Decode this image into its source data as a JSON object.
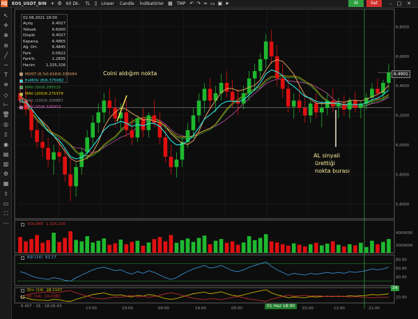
{
  "toolbar": {
    "logo": "iQ",
    "symbol": "EOS_USDT_BIN",
    "add_icon": "+",
    "interval": "60 Dk.",
    "currency": "TL",
    "scale": "Lineer",
    "chart_type": "Candle",
    "indicators": "İndikatörler",
    "template": "TMP",
    "buy": "Al",
    "sell": "Sat"
  },
  "sidebar": {
    "icons": [
      "pointer-icon",
      "crosshair-icon",
      "zoom-in-icon",
      "zoom-out-icon",
      "trendline-icon",
      "horizontal-line-icon",
      "text-icon",
      "fibonacci-icon",
      "shapes-icon",
      "ruler-icon",
      "delete-icon",
      "magnet-icon",
      "lock-icon",
      "eye-icon",
      "layers-icon",
      "template-icon",
      "settings-icon",
      "grid-icon",
      "export-icon",
      "print-icon",
      "fullscreen-icon",
      "more-icon"
    ]
  },
  "infobox": {
    "date": "02.06.2021 18:00",
    "rows": [
      {
        "label": "Açılış",
        "value": "6.4027"
      },
      {
        "label": "Yüksek",
        "value": "6.6000"
      },
      {
        "label": "Düşük",
        "value": "6.4027"
      },
      {
        "label": "Kapanış",
        "value": "6.4865"
      },
      {
        "label": "Ağ. Ort.",
        "value": "6.4845"
      },
      {
        "label": "Fark",
        "value": "0.0622"
      },
      {
        "label": "Fark%",
        "value": "1.2835"
      },
      {
        "label": "Hacim",
        "value": "1,325,326"
      }
    ]
  },
  "legend": [
    {
      "text": "MOST (8,%0.618)6.335684",
      "color": "#e8a060"
    },
    {
      "text": "ExMOV (8)6.375082",
      "color": "#2ee8e8"
    },
    {
      "text": "MAV (50)6.285525",
      "color": "#3ab04a"
    },
    {
      "text": "MAV (200)6.275379",
      "color": "#f0d000"
    },
    {
      "text": "MAV (100)6.206887",
      "color": "#555555"
    },
    {
      "text": "MAV (20)6.326933",
      "color": "#e060c0"
    }
  ],
  "annotations": {
    "bought": "Coini aldığım nokta",
    "signal_line1": "AL sinyali",
    "signal_line2": "ürettiği",
    "signal_line3": "nokta burası"
  },
  "price_axis": {
    "labels": [
      "6,8000",
      "6,6000",
      "6,4000",
      "6,2000",
      "6,0000",
      "5,8000",
      "5,6000"
    ],
    "last_price": "6.4901"
  },
  "volume_panel": {
    "label": "VOLUME",
    "value": "1,325,326",
    "axis_labels": [
      "4000000",
      "2000000"
    ],
    "color": "#d02020"
  },
  "rsi_panel": {
    "label": "RSI (14)",
    "value": "61.17",
    "axis_labels": [
      "80.00",
      "60.00",
      "40.00"
    ],
    "color": "#3a8fd0"
  },
  "dmi_panel": {
    "label_plus": "DI+ (14)",
    "value_plus": "28.1107",
    "label_minus": "DI- (14)",
    "value_minus": "19.2383",
    "axis_labels": [
      "20.00"
    ],
    "tag_value": "34",
    "color_plus": "#e8c800",
    "color_minus": "#d03030"
  },
  "time_axis": {
    "labels": [
      "13:00",
      "23:00",
      "09:00",
      "19:00",
      "05:00",
      "15:00",
      "01:00",
      "11:00",
      "21:00"
    ],
    "cursor_label": "01 Haz 18:00",
    "status": "6.407 - 16 - 18:26:43"
  },
  "colors": {
    "up": "#1fb82f",
    "down": "#e01010",
    "background": "#0d0d0d",
    "grid": "#222222"
  },
  "chart_data": {
    "type": "candlestick",
    "ylim": [
      5.5,
      6.92
    ],
    "candles": [
      [
        6.35,
        6.42,
        6.25,
        6.3
      ],
      [
        6.3,
        6.38,
        6.2,
        6.24
      ],
      [
        6.24,
        6.3,
        6.05,
        6.1
      ],
      [
        6.1,
        6.18,
        5.98,
        6.02
      ],
      [
        6.02,
        6.1,
        5.92,
        5.98
      ],
      [
        5.98,
        6.05,
        5.85,
        5.9
      ],
      [
        5.9,
        6.0,
        5.8,
        5.95
      ],
      [
        5.95,
        6.05,
        5.88,
        5.92
      ],
      [
        5.92,
        5.98,
        5.75,
        5.8
      ],
      [
        5.8,
        5.9,
        5.62,
        5.72
      ],
      [
        5.72,
        5.88,
        5.65,
        5.85
      ],
      [
        5.85,
        5.98,
        5.8,
        5.95
      ],
      [
        5.95,
        6.1,
        5.9,
        6.05
      ],
      [
        6.05,
        6.2,
        6.0,
        6.15
      ],
      [
        6.15,
        6.28,
        6.08,
        6.22
      ],
      [
        6.22,
        6.35,
        6.15,
        6.3
      ],
      [
        6.3,
        6.38,
        6.2,
        6.25
      ],
      [
        6.25,
        6.32,
        6.12,
        6.18
      ],
      [
        6.18,
        6.28,
        6.1,
        6.22
      ],
      [
        6.22,
        6.3,
        6.05,
        6.1
      ],
      [
        6.1,
        6.18,
        6.0,
        6.05
      ],
      [
        6.05,
        6.2,
        6.02,
        6.18
      ],
      [
        6.18,
        6.25,
        6.05,
        6.1
      ],
      [
        6.1,
        6.22,
        6.05,
        6.2
      ],
      [
        6.2,
        6.3,
        6.12,
        6.15
      ],
      [
        6.15,
        6.22,
        6.0,
        6.05
      ],
      [
        6.05,
        6.1,
        5.88,
        5.92
      ],
      [
        5.92,
        6.0,
        5.8,
        5.85
      ],
      [
        5.85,
        5.95,
        5.78,
        5.9
      ],
      [
        5.9,
        6.05,
        5.85,
        6.02
      ],
      [
        6.02,
        6.15,
        5.98,
        6.1
      ],
      [
        6.1,
        6.25,
        6.05,
        6.2
      ],
      [
        6.2,
        6.35,
        6.15,
        6.3
      ],
      [
        6.3,
        6.42,
        6.22,
        6.38
      ],
      [
        6.38,
        6.45,
        6.25,
        6.3
      ],
      [
        6.3,
        6.4,
        6.22,
        6.35
      ],
      [
        6.35,
        6.48,
        6.3,
        6.42
      ],
      [
        6.42,
        6.5,
        6.32,
        6.36
      ],
      [
        6.36,
        6.44,
        6.25,
        6.3
      ],
      [
        6.3,
        6.38,
        6.2,
        6.28
      ],
      [
        6.28,
        6.4,
        6.24,
        6.35
      ],
      [
        6.35,
        6.5,
        6.3,
        6.45
      ],
      [
        6.45,
        6.55,
        6.38,
        6.5
      ],
      [
        6.5,
        6.62,
        6.45,
        6.58
      ],
      [
        6.58,
        6.75,
        6.52,
        6.7
      ],
      [
        6.7,
        6.78,
        6.55,
        6.6
      ],
      [
        6.6,
        6.68,
        6.4,
        6.45
      ],
      [
        6.45,
        6.55,
        6.32,
        6.38
      ],
      [
        6.38,
        6.45,
        6.22,
        6.26
      ],
      [
        6.26,
        6.35,
        6.18,
        6.3
      ],
      [
        6.3,
        6.4,
        6.22,
        6.25
      ],
      [
        6.25,
        6.32,
        6.15,
        6.2
      ],
      [
        6.2,
        6.3,
        6.15,
        6.28
      ],
      [
        6.28,
        6.35,
        6.18,
        6.22
      ],
      [
        6.22,
        6.3,
        6.12,
        6.25
      ],
      [
        6.25,
        6.35,
        6.2,
        6.3
      ],
      [
        6.3,
        6.38,
        6.22,
        6.26
      ],
      [
        6.26,
        6.32,
        6.18,
        6.28
      ],
      [
        6.28,
        6.34,
        6.2,
        6.24
      ],
      [
        6.24,
        6.32,
        6.18,
        6.3
      ],
      [
        6.3,
        6.36,
        6.22,
        6.25
      ],
      [
        6.25,
        6.3,
        6.18,
        6.28
      ],
      [
        6.28,
        6.35,
        6.24,
        6.32
      ],
      [
        6.32,
        6.42,
        6.28,
        6.38
      ],
      [
        6.38,
        6.45,
        6.3,
        6.35
      ],
      [
        6.35,
        6.44,
        6.3,
        6.42
      ],
      [
        6.42,
        6.55,
        6.38,
        6.49
      ]
    ],
    "volume": [
      55,
      40,
      48,
      62,
      35,
      44,
      70,
      38,
      52,
      75,
      45,
      40,
      58,
      36,
      42,
      50,
      28,
      33,
      46,
      30,
      38,
      42,
      25,
      36,
      48,
      55,
      40,
      62,
      35,
      44,
      50,
      38,
      52,
      60,
      30,
      42,
      48,
      35,
      40,
      28,
      36,
      58,
      44,
      52,
      65,
      40,
      36,
      30,
      25,
      33,
      28,
      22,
      30,
      35,
      26,
      32,
      40,
      28,
      22,
      30,
      26,
      35,
      20,
      42,
      30,
      38,
      48
    ],
    "rsi": [
      52,
      48,
      42,
      38,
      36,
      34,
      38,
      36,
      32,
      30,
      38,
      44,
      50,
      56,
      60,
      62,
      58,
      54,
      56,
      50,
      46,
      52,
      48,
      54,
      50,
      44,
      38,
      34,
      38,
      46,
      52,
      58,
      62,
      66,
      60,
      62,
      66,
      60,
      54,
      52,
      56,
      62,
      66,
      70,
      74,
      64,
      56,
      50,
      44,
      48,
      46,
      44,
      48,
      46,
      48,
      50,
      48,
      50,
      48,
      52,
      50,
      52,
      54,
      58,
      56,
      58,
      62
    ],
    "di_plus": [
      20,
      18,
      14,
      12,
      12,
      11,
      14,
      13,
      10,
      9,
      14,
      18,
      22,
      26,
      28,
      30,
      26,
      24,
      25,
      22,
      20,
      24,
      22,
      26,
      24,
      20,
      16,
      14,
      16,
      20,
      24,
      28,
      30,
      32,
      28,
      30,
      33,
      28,
      24,
      22,
      25,
      29,
      32,
      35,
      38,
      30,
      25,
      22,
      18,
      20,
      19,
      18,
      21,
      20,
      21,
      22,
      21,
      22,
      21,
      23,
      22,
      23,
      24,
      26,
      25,
      26,
      28
    ],
    "di_minus": [
      22,
      24,
      28,
      30,
      31,
      33,
      30,
      31,
      34,
      36,
      30,
      26,
      22,
      18,
      16,
      15,
      18,
      20,
      19,
      22,
      24,
      20,
      22,
      19,
      21,
      24,
      28,
      30,
      28,
      24,
      20,
      17,
      15,
      13,
      16,
      15,
      13,
      16,
      19,
      21,
      18,
      15,
      13,
      11,
      9,
      14,
      18,
      21,
      25,
      22,
      23,
      24,
      22,
      23,
      22,
      21,
      22,
      21,
      22,
      20,
      21,
      20,
      19,
      18,
      19,
      19,
      19
    ]
  }
}
